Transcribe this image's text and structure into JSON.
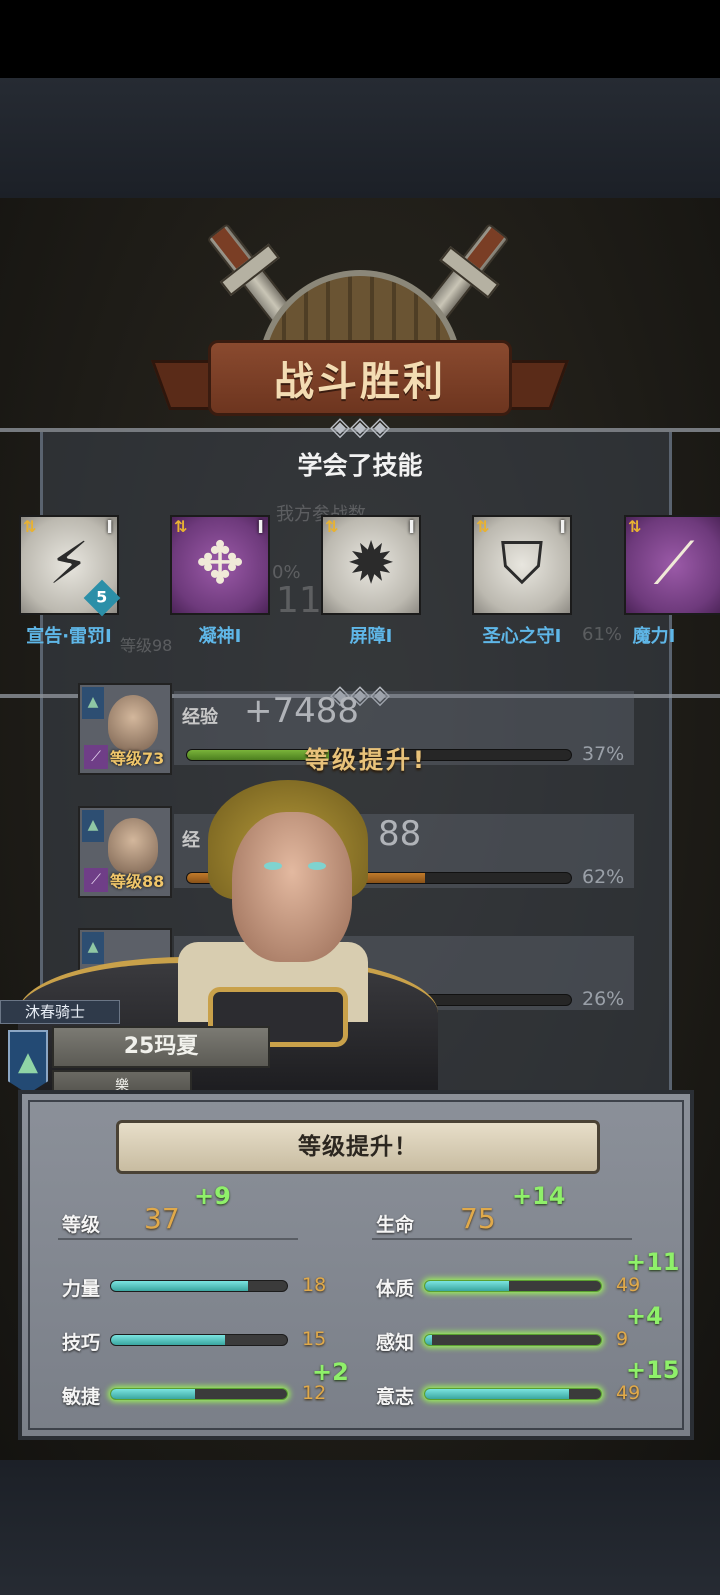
{
  "header": {
    "title": "战斗胜利",
    "subtitle": "学会了技能"
  },
  "ghost_text": {
    "team_label": "我方参战数",
    "pct_zero": "0%",
    "num": "11",
    "lvl": "等级98",
    "pct_61": "61%"
  },
  "skills": [
    {
      "name": "宣告·雷罚I",
      "rank": "I",
      "icon": "spear-lightning-icon",
      "badge": "5",
      "style": "light"
    },
    {
      "name": "凝神I",
      "rank": "I",
      "icon": "crosshair-icon",
      "badge": "",
      "style": "purple"
    },
    {
      "name": "屏障I",
      "rank": "I",
      "icon": "barrier-burst-icon",
      "badge": "",
      "style": "light"
    },
    {
      "name": "圣心之守I",
      "rank": "I",
      "icon": "holy-shield-icon",
      "badge": "",
      "style": "light"
    },
    {
      "name": "魔力I",
      "rank": "I",
      "icon": "magic-staff-icon",
      "badge": "",
      "style": "purple"
    }
  ],
  "party": [
    {
      "level": "等级73",
      "exp_label": "经验",
      "exp_value": "+7488",
      "percent_text": "37%",
      "percent": 37,
      "bar": "green"
    },
    {
      "level": "等级88",
      "exp_label": "经",
      "exp_value": "88",
      "percent_text": "62%",
      "percent": 62,
      "bar": "orange"
    },
    {
      "level": "",
      "exp_label": "",
      "exp_value": "",
      "percent_text": "26%",
      "percent": 26,
      "bar": "green"
    }
  ],
  "level_up_overlay": "等级提升!",
  "character": {
    "order": "沐春骑士",
    "name": "25玛夏",
    "title": "樂"
  },
  "stats_panel": {
    "button": "等级提升！",
    "level": {
      "label": "等级",
      "value": "37",
      "inc": "+9"
    },
    "hp": {
      "label": "生命",
      "value": "75",
      "inc": "+14"
    },
    "left": [
      {
        "label": "力量",
        "value": "18",
        "fill": 0.78,
        "inc": "",
        "glow": false
      },
      {
        "label": "技巧",
        "value": "15",
        "fill": 0.65,
        "inc": "",
        "glow": false
      },
      {
        "label": "敏捷",
        "value": "12",
        "fill": 0.48,
        "inc": "+2",
        "glow": true
      }
    ],
    "right": [
      {
        "label": "体质",
        "value": "49",
        "fill": 0.48,
        "inc": "+11",
        "glow": true
      },
      {
        "label": "感知",
        "value": "9",
        "fill": 0.04,
        "inc": "+4",
        "glow": true
      },
      {
        "label": "意志",
        "value": "49",
        "fill": 0.82,
        "inc": "+15",
        "glow": true
      }
    ]
  },
  "colors": {
    "accent_orange": "#e0a94a",
    "increase_green": "#8ff06a",
    "skill_name_blue": "#5fb7e8"
  }
}
